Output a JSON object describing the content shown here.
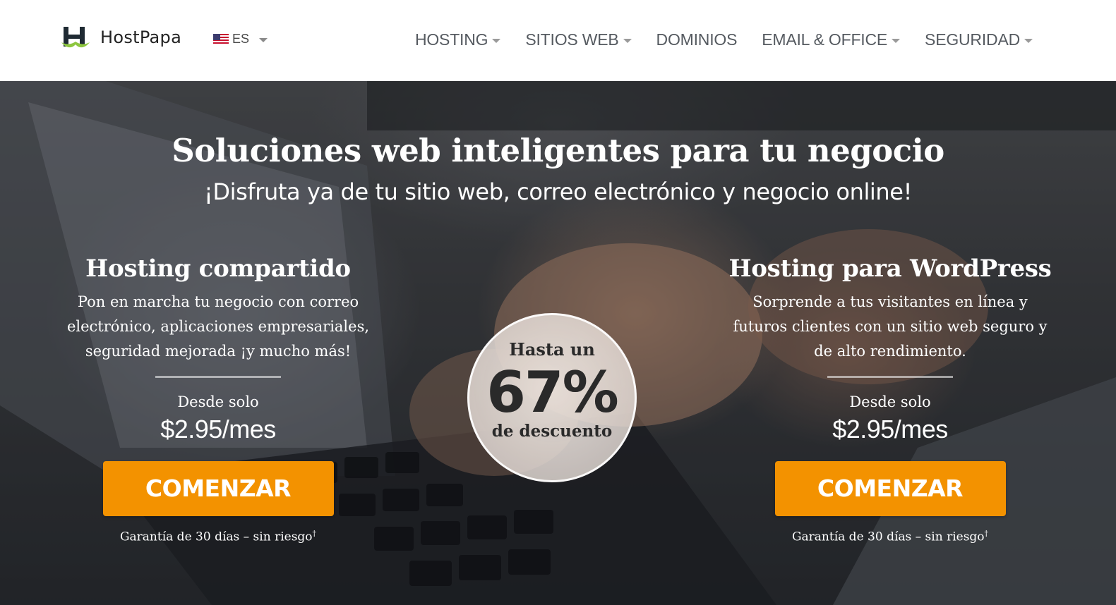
{
  "header": {
    "logo_text": "HostPapa",
    "language": {
      "code": "ES",
      "flag": "us-flag-icon"
    },
    "nav": [
      {
        "label": "HOSTING",
        "dropdown": true
      },
      {
        "label": "SITIOS WEB",
        "dropdown": true
      },
      {
        "label": "DOMINIOS",
        "dropdown": false
      },
      {
        "label": "EMAIL & OFFICE",
        "dropdown": true
      },
      {
        "label": "SEGURIDAD",
        "dropdown": true
      }
    ]
  },
  "hero": {
    "headline": "Soluciones web inteligentes para tu negocio",
    "subline": "¡Disfruta ya de tu sitio web, correo electrónico y negocio online!",
    "badge": {
      "top": "Hasta un",
      "percent": "67%",
      "bottom": "de descuento"
    },
    "plans": [
      {
        "title": "Hosting compartido",
        "description": "Pon en marcha tu negocio con correo electrónico, aplicaciones empresariales, seguridad mejorada ¡y mucho más!",
        "from_label": "Desde solo",
        "price": "$2.95/mes",
        "cta": "COMENZAR",
        "guarantee": "Garantía de 30 días – sin riesgo",
        "guarantee_mark": "†"
      },
      {
        "title": "Hosting para WordPress",
        "description": "Sorprende a tus visitantes en línea y futuros clientes con un sitio web seguro y de alto rendimiento.",
        "from_label": "Desde solo",
        "price": "$2.95/mes",
        "cta": "COMENZAR",
        "guarantee": "Garantía de 30 días – sin riesgo",
        "guarantee_mark": "†"
      }
    ]
  },
  "colors": {
    "accent_orange": "#f39200",
    "logo_green": "#8dc63f",
    "logo_dark": "#1f2a33",
    "nav_text": "#555a60"
  }
}
